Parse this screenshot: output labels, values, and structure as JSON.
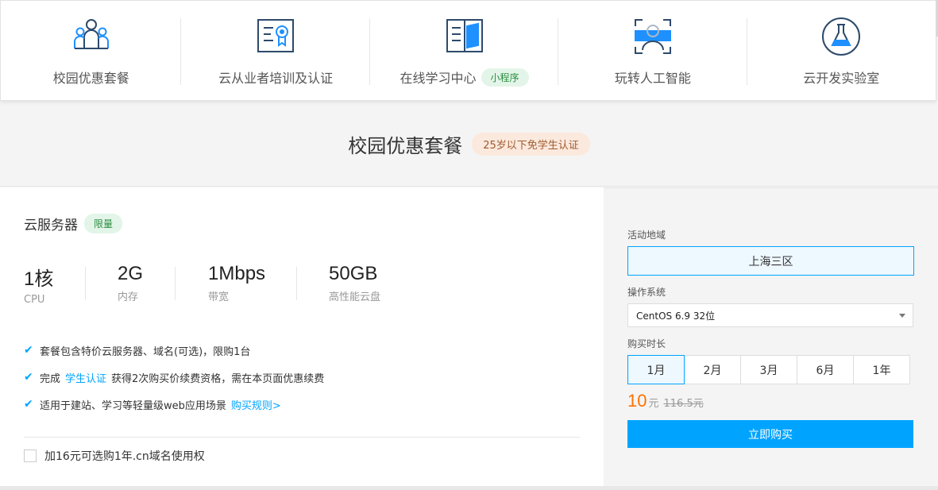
{
  "nav": {
    "items": [
      {
        "label": "校园优惠套餐",
        "icon": "people-group-icon"
      },
      {
        "label": "云从业者培训及认证",
        "icon": "certificate-icon"
      },
      {
        "label": "在线学习中心",
        "icon": "book-icon",
        "badge": "小程序"
      },
      {
        "label": "玩转人工智能",
        "icon": "face-scan-icon"
      },
      {
        "label": "云开发实验室",
        "icon": "flask-icon"
      }
    ]
  },
  "section": {
    "title": "校园优惠套餐",
    "tag": "25岁以下免学生认证"
  },
  "product": {
    "title": "云服务器",
    "badge": "限量",
    "specs": [
      {
        "value": "1核",
        "label": "CPU"
      },
      {
        "value": "2G",
        "label": "内存"
      },
      {
        "value": "1Mbps",
        "label": "带宽"
      },
      {
        "value": "50GB",
        "label": "高性能云盘"
      }
    ],
    "features": {
      "f1": "套餐包含特价云服务器、域名(可选)，限购1台",
      "f2_pre": "完成",
      "f2_link": "学生认证",
      "f2_post": "获得2次购买价续费资格，需在本页面优惠续费",
      "f3": "适用于建站、学习等轻量级web应用场景",
      "f3_link": "购买规则>"
    },
    "addon": "加16元可选购1年.cn域名使用权"
  },
  "order": {
    "region_label": "活动地域",
    "region_value": "上海三区",
    "os_label": "操作系统",
    "os_value": "CentOS 6.9 32位",
    "duration_label": "购买时长",
    "durations": [
      "1月",
      "2月",
      "3月",
      "6月",
      "1年"
    ],
    "selected_duration": "1月",
    "price": "10",
    "price_unit": "元",
    "original_price": "116.5元",
    "buy_label": "立即购买"
  },
  "colors": {
    "accent": "#00a4ff",
    "price": "#ff7200",
    "badge_green_bg": "#e3f5e8",
    "tag_peach_bg": "#fbe9de"
  }
}
